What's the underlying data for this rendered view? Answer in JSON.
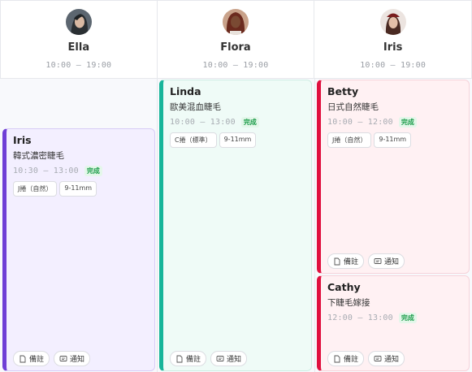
{
  "staff": [
    {
      "name": "Ella",
      "hours": "10:00 – 19:00",
      "avatar_icon": "staff-photo-ella"
    },
    {
      "name": "Flora",
      "hours": "10:00 – 19:00",
      "avatar_icon": "staff-photo-flora"
    },
    {
      "name": "Iris",
      "hours": "10:00 – 19:00",
      "avatar_icon": "staff-photo-iris"
    }
  ],
  "appointments": [
    {
      "client": "Iris",
      "service": "韓式濃密睫毛",
      "time": "10:30 – 13:00",
      "status": "完成",
      "tags": [
        "J捲（自然）",
        "9-11mm"
      ],
      "note_label": "備註",
      "notify_label": "通知",
      "accent": "#6f3fd6"
    },
    {
      "client": "Linda",
      "service": "歐美混血睫毛",
      "time": "10:00 – 13:00",
      "status": "完成",
      "tags": [
        "C捲（標準）",
        "9-11mm"
      ],
      "note_label": "備註",
      "notify_label": "通知",
      "accent": "#17b59a"
    },
    {
      "client": "Betty",
      "service": "日式自然睫毛",
      "time": "10:00 – 12:00",
      "status": "完成",
      "tags": [
        "J捲（自然）",
        "9-11mm"
      ],
      "note_label": "備註",
      "notify_label": "通知",
      "accent": "#e0103f"
    },
    {
      "client": "Cathy",
      "service": "下睫毛嫁接",
      "time": "12:00 – 13:00",
      "status": "完成",
      "tags": [],
      "note_label": "備註",
      "notify_label": "通知",
      "accent": "#e0103f"
    }
  ]
}
